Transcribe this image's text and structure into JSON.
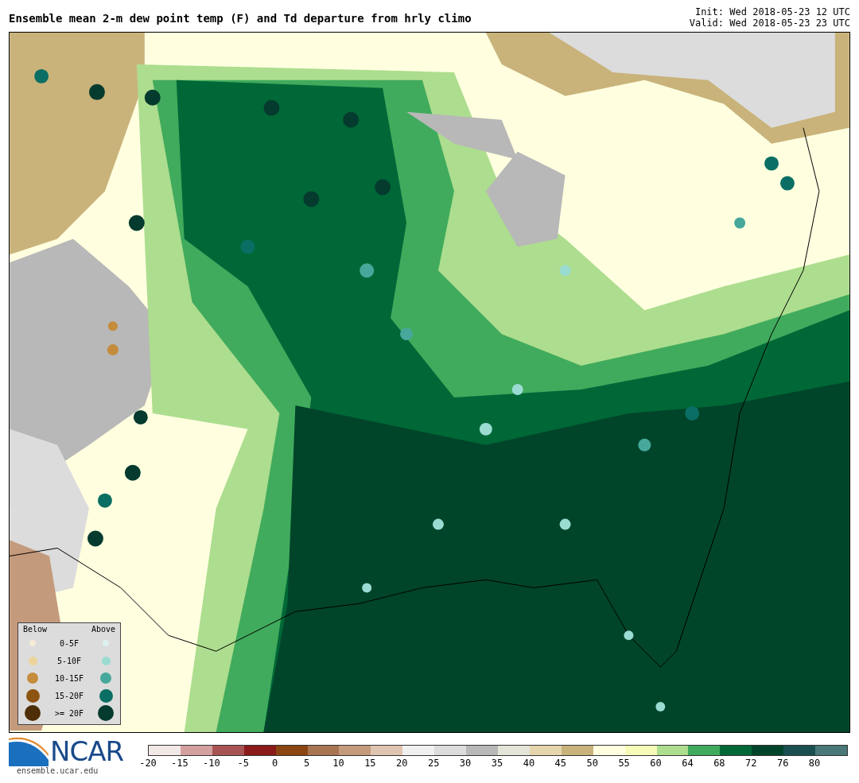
{
  "title": "Ensemble mean 2-m dew point temp (F) and Td departure from hrly climo",
  "init": "Init: Wed 2018-05-23 12 UTC",
  "valid": "Valid: Wed 2018-05-23 23 UTC",
  "legend": {
    "below_label": "Below",
    "above_label": "Above",
    "rows": [
      {
        "label": "0-5F",
        "below": {
          "color": "#f5ecd6"
        },
        "above": {
          "color": "#dcf0f0"
        }
      },
      {
        "label": "5-10F",
        "below": {
          "color": "#ecd49a"
        },
        "above": {
          "color": "#9adcd2"
        }
      },
      {
        "label": "10-15F",
        "below": {
          "color": "#c48c3c"
        },
        "above": {
          "color": "#46a89a"
        }
      },
      {
        "label": "15-20F",
        "below": {
          "color": "#8c5410"
        },
        "above": {
          "color": "#0a6e64"
        }
      },
      {
        "label": ">= 20F",
        "below": {
          "color": "#4e2e06"
        },
        "above": {
          "color": "#053a2e"
        }
      }
    ]
  },
  "logo": {
    "text": "NCAR",
    "url": "ensemble.ucar.edu"
  },
  "colorbar": [
    {
      "color": "#f2e8e6",
      "label": "-20"
    },
    {
      "color": "#d4a0a0",
      "label": "-15"
    },
    {
      "color": "#a85454",
      "label": "-10"
    },
    {
      "color": "#8b1a1a",
      "label": "-5"
    },
    {
      "color": "#8b4513",
      "label": "0"
    },
    {
      "color": "#a87452",
      "label": "5"
    },
    {
      "color": "#c49a7c",
      "label": "10"
    },
    {
      "color": "#dfc4b0",
      "label": "15"
    },
    {
      "color": "#f0f0f0",
      "label": "20"
    },
    {
      "color": "#dcdcdc",
      "label": "25"
    },
    {
      "color": "#b8b8b8",
      "label": "30"
    },
    {
      "color": "#e4e4d8",
      "label": "35"
    },
    {
      "color": "#e5d5ad",
      "label": "40"
    },
    {
      "color": "#c9b37a",
      "label": "45"
    },
    {
      "color": "#ffffe0",
      "label": "50"
    },
    {
      "color": "#f7fbb8",
      "label": "55"
    },
    {
      "color": "#addd8e",
      "label": "60"
    },
    {
      "color": "#41ab5d",
      "label": "64"
    },
    {
      "color": "#006837",
      "label": "68"
    },
    {
      "color": "#004529",
      "label": "72"
    },
    {
      "color": "#1a4f52",
      "label": "76"
    },
    {
      "color": "#4a7878",
      "label": "80"
    }
  ]
}
